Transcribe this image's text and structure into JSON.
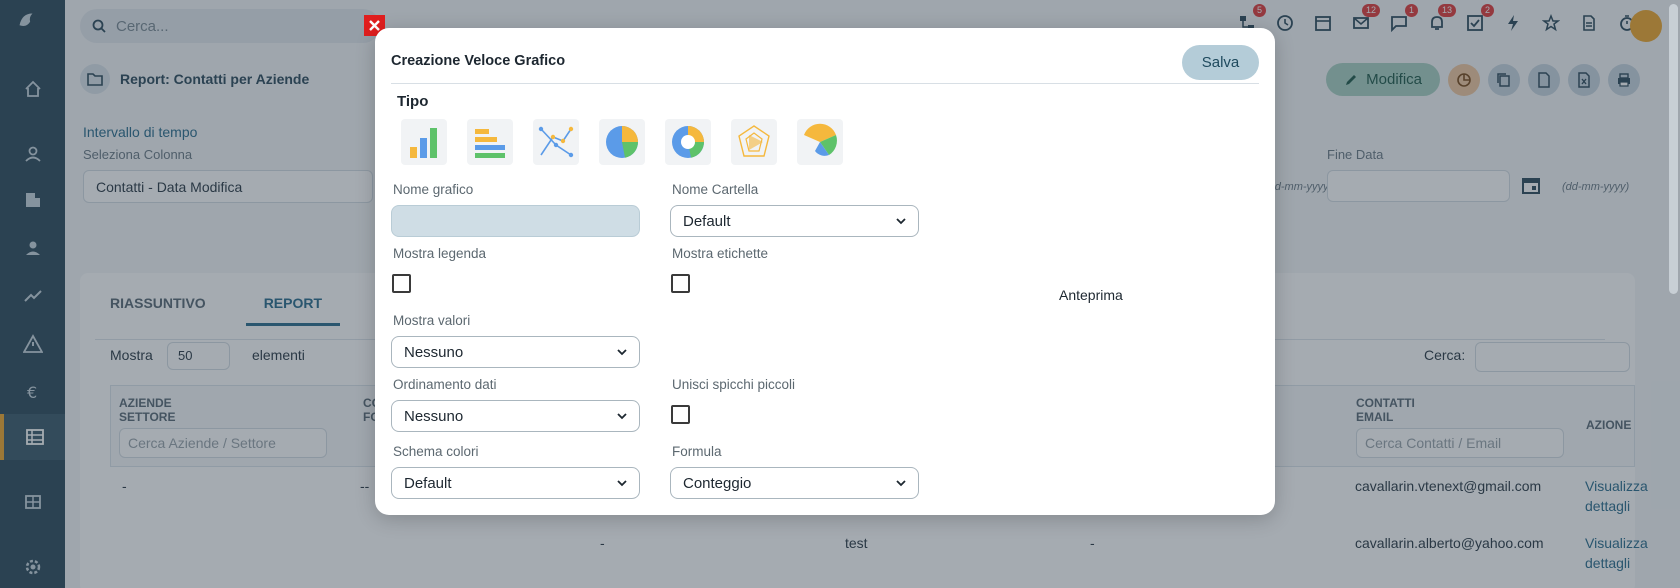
{
  "topbar": {
    "search_placeholder": "Cerca...",
    "badges": [
      "5",
      "12",
      "1",
      "13",
      "2"
    ]
  },
  "breadcrumb": {
    "title": "Report: Contatti per Aziende"
  },
  "actions": {
    "modifica_label": "Modifica"
  },
  "filters": {
    "time_interval_label": "Intervallo di tempo",
    "select_column_label": "Seleziona Colonna",
    "select_column_value": "Contatti - Data Modifica",
    "date_format_hint_left": "(dd-mm-yyyy)",
    "end_date_label": "Fine Data",
    "date_format_hint": "(dd-mm-yyyy)"
  },
  "tabs": [
    "RIASSUNTIVO",
    "REPORT"
  ],
  "table": {
    "show_label": "Mostra",
    "show_value": "50",
    "elements_label": "elementi",
    "search_label": "Cerca:",
    "col1_line1": "AZIENDE",
    "col1_line2": "SETTORE",
    "col1_search": "Cerca Aziende / Settore",
    "col2_line1": "CO",
    "col2_line2": "FO",
    "col_email_line1": "CONTATTI",
    "col_email_line2": "EMAIL",
    "col_email_search": "Cerca Contatti / Email",
    "col_action": "AZIONE",
    "rows": [
      {
        "c1": "-",
        "c2": "--",
        "email": "cavallarin.vtenext@gmail.com",
        "action_1": "Visualizza",
        "action_2": "dettagli"
      },
      {
        "c3": "-",
        "c4": "test",
        "c5": "-",
        "email": "cavallarin.alberto@yahoo.com",
        "action_1": "Visualizza",
        "action_2": "dettagli"
      }
    ]
  },
  "modal": {
    "title": "Creazione Veloce Grafico",
    "save_label": "Salva",
    "tipo_label": "Tipo",
    "chart_types": [
      "bar-vertical-icon",
      "bar-horizontal-icon",
      "line-icon",
      "pie-icon",
      "donut-icon",
      "radar-icon",
      "polar-icon"
    ],
    "nome_grafico_label": "Nome grafico",
    "nome_cartella_label": "Nome Cartella",
    "nome_cartella_value": "Default",
    "mostra_legenda_label": "Mostra legenda",
    "mostra_etichette_label": "Mostra etichette",
    "mostra_valori_label": "Mostra valori",
    "mostra_valori_value": "Nessuno",
    "ordinamento_label": "Ordinamento dati",
    "ordinamento_value": "Nessuno",
    "unisci_label": "Unisci spicchi piccoli",
    "schema_label": "Schema colori",
    "schema_value": "Default",
    "formula_label": "Formula",
    "formula_value": "Conteggio",
    "preview_label": "Anteprima"
  },
  "colors": {
    "sidebar": "#2d4b5c",
    "accent": "#2b6d8d",
    "active_marker": "#f0a72d",
    "close": "#e01e1e"
  }
}
